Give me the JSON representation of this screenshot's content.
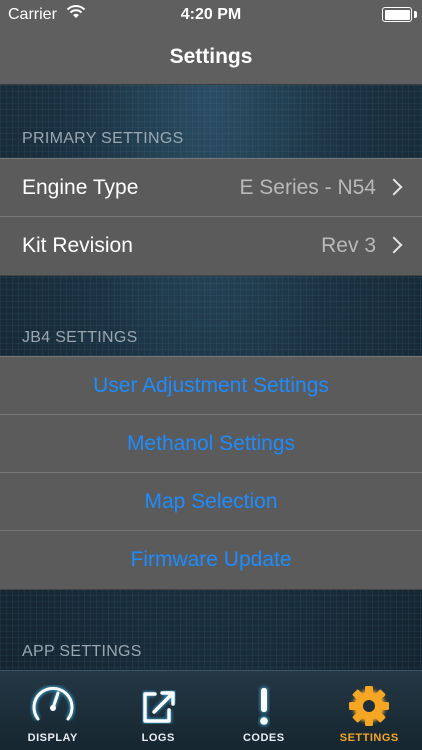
{
  "status_bar": {
    "carrier": "Carrier",
    "time": "4:20 PM",
    "battery_level": 1.0
  },
  "nav": {
    "title": "Settings"
  },
  "sections": {
    "primary": {
      "header": "PRIMARY SETTINGS",
      "rows": [
        {
          "label": "Engine Type",
          "value": "E Series - N54"
        },
        {
          "label": "Kit Revision",
          "value": "Rev 3"
        }
      ]
    },
    "jb4": {
      "header": "JB4 SETTINGS",
      "actions": [
        "User Adjustment Settings",
        "Methanol Settings",
        "Map Selection",
        "Firmware Update"
      ]
    },
    "app": {
      "header": "APP SETTINGS"
    }
  },
  "tab_bar": {
    "tabs": [
      {
        "label": "DISPLAY",
        "icon": "gauge-icon",
        "active": false
      },
      {
        "label": "LOGS",
        "icon": "export-log-icon",
        "active": false
      },
      {
        "label": "CODES",
        "icon": "exclamation-icon",
        "active": false
      },
      {
        "label": "SETTINGS",
        "icon": "gear-icon",
        "active": true
      }
    ]
  },
  "colors": {
    "accent": "#1e8cff",
    "active_tab": "#f5a623",
    "tab_glow": "#3aaee0"
  }
}
